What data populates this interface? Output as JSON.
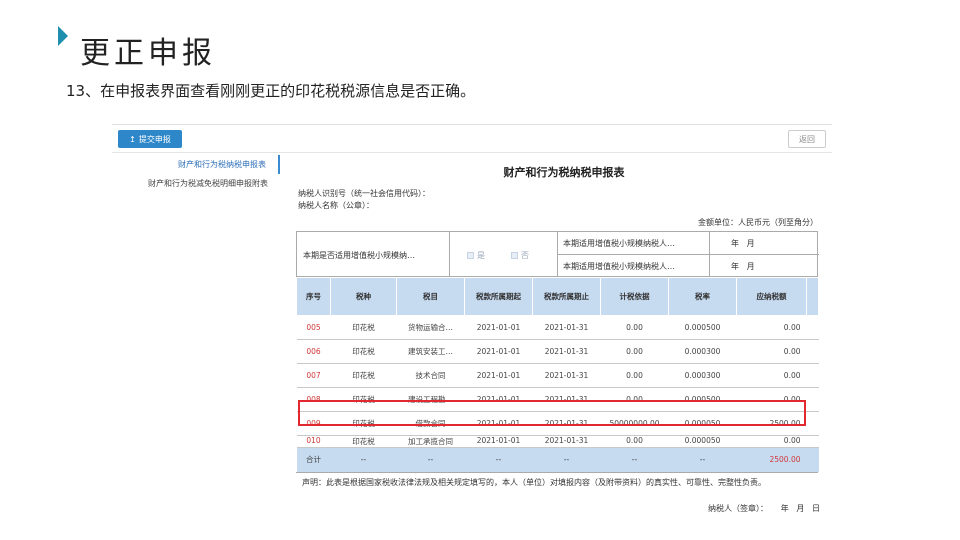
{
  "slide": {
    "title": "更正申报",
    "instruction": "13、在申报表界面查看刚刚更正的印花税税源信息是否正确。"
  },
  "toolbar": {
    "submit_label": "提交申报",
    "submit_icon": "upload-icon",
    "back_label": "返回"
  },
  "sidebar": {
    "items": [
      {
        "label": "财产和行为税纳税申报表"
      },
      {
        "label": "财产和行为税减免税明细申报附表"
      }
    ]
  },
  "form": {
    "title": "财产和行为税纳税申报表",
    "taxpayer_id_label": "纳税人识别号（统一社会信用代码）：",
    "taxpayer_name_label": "纳税人名称（公章）：",
    "unit_label": "金额单位：人民币元（列至角分）",
    "small_scale_question": "本期是否适用增值税小规模纳…",
    "option_yes": "是",
    "option_no": "否",
    "period_start_label": "本期适用增值税小规模纳税人…",
    "period_end_label": "本期适用增值税小规模纳税人…",
    "year_month": "年   月",
    "columns": [
      "序号",
      "税种",
      "税目",
      "税款所属期起",
      "税款所属期止",
      "计税依据",
      "税率",
      "应纳税额"
    ],
    "rows": [
      {
        "seq": "005",
        "tax": "印花税",
        "item": "货物运输合…",
        "start": "2021-01-01",
        "end": "2021-01-31",
        "base": "0.00",
        "rate": "0.000500",
        "due": "0.00"
      },
      {
        "seq": "006",
        "tax": "印花税",
        "item": "建筑安装工…",
        "start": "2021-01-01",
        "end": "2021-01-31",
        "base": "0.00",
        "rate": "0.000300",
        "due": "0.00"
      },
      {
        "seq": "007",
        "tax": "印花税",
        "item": "技术合同",
        "start": "2021-01-01",
        "end": "2021-01-31",
        "base": "0.00",
        "rate": "0.000300",
        "due": "0.00"
      },
      {
        "seq": "008",
        "tax": "印花税",
        "item": "建设工程勘…",
        "start": "2021-01-01",
        "end": "2021-01-31",
        "base": "0.00",
        "rate": "0.000500",
        "due": "0.00"
      },
      {
        "seq": "009",
        "tax": "印花税",
        "item": "借款合同",
        "start": "2021-01-01",
        "end": "2021-01-31",
        "base": "50000000.00",
        "rate": "0.000050",
        "due": "2500.00"
      },
      {
        "seq": "010",
        "tax": "印花税",
        "item": "加工承揽合同",
        "start": "2021-01-01",
        "end": "2021-01-31",
        "base": "0.00",
        "rate": "0.000050",
        "due": "0.00"
      }
    ],
    "total": {
      "label": "合计",
      "dash": "--",
      "due": "2500.00"
    },
    "declaration": "声明：此表是根据国家税收法律法规及相关规定填写的，本人（单位）对填报内容（及附带资料）的真实性、可靠性、完整性负责。",
    "signature": "纳税人（签章）：     年   月   日"
  },
  "colors": {
    "accent": "#2d87c8",
    "header_bg": "#c6daf0",
    "highlight": "#e0282e",
    "seq_text": "#d0393a"
  }
}
